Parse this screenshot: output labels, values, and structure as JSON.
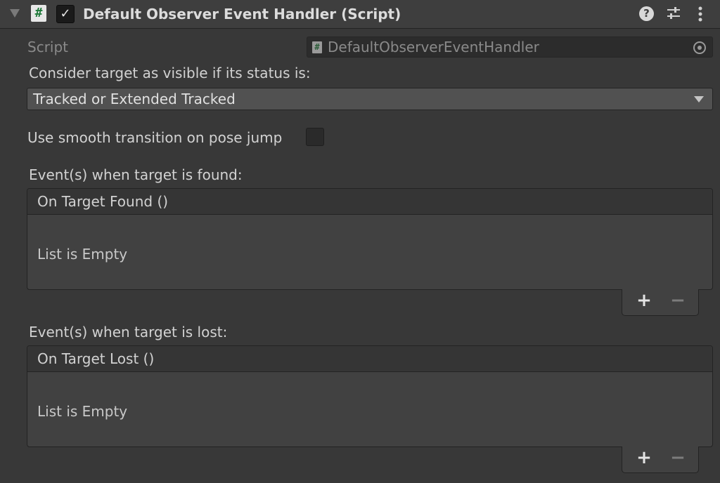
{
  "component": {
    "title": "Default Observer Event Handler (Script)",
    "script_icon_glyph": "#",
    "enabled_check_glyph": "✓",
    "help_glyph": "?"
  },
  "script_field": {
    "label": "Script",
    "value": "DefaultObserverEventHandler",
    "icon_glyph": "#"
  },
  "status": {
    "label": "Consider target as visible if its status is:",
    "selected": "Tracked or Extended Tracked"
  },
  "smooth": {
    "label": "Use smooth transition on pose jump",
    "checked": false
  },
  "found": {
    "label": "Event(s) when target is found:",
    "header": "On Target Found ()",
    "empty_text": "List is Empty",
    "add_glyph": "+",
    "remove_glyph": "−"
  },
  "lost": {
    "label": "Event(s) when target is lost:",
    "header": "On Target Lost ()",
    "empty_text": "List is Empty",
    "add_glyph": "+",
    "remove_glyph": "−"
  },
  "icons": [
    "fold-arrow-icon",
    "script-icon",
    "checkmark-icon",
    "help-icon",
    "preset-icon",
    "context-menu-icon",
    "object-picker-icon",
    "dropdown-arrow-icon",
    "plus-icon",
    "minus-icon"
  ]
}
